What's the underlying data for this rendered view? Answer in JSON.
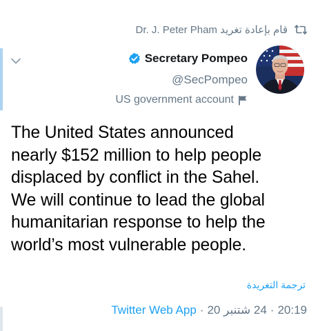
{
  "colors": {
    "accent": "#1da1f2",
    "muted": "#657786",
    "text": "#14171a",
    "rail": "#aed3f0"
  },
  "retweet": {
    "text": "Dr. J. Peter Pham قام بإعادة تغريد",
    "icon": "retweet-icon"
  },
  "author": {
    "name": "Secretary Pompeo",
    "handle": "@SecPompeo",
    "label": "US government account",
    "verified_icon": "verified-badge-icon",
    "label_icon": "flag-icon",
    "avatar_icon": "avatar"
  },
  "menu_icon": "chevron-down-icon",
  "tweet": {
    "lines": [
      "The United States announced",
      "nearly $152 million to help people",
      "displaced by conflict in the Sahel.",
      "We will continue to lead the global",
      "humanitarian response to help the",
      "world’s most vulnerable people."
    ]
  },
  "translate_label": "ترجمة التغريدة",
  "meta": {
    "time": "20:19",
    "date": "24 شتنبر 20",
    "separator": "·",
    "app": "Twitter Web App"
  }
}
